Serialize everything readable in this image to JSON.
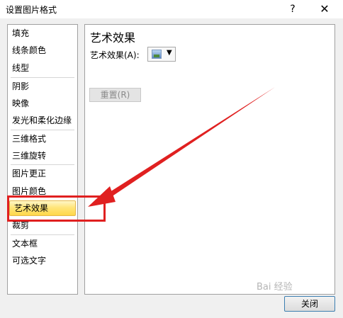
{
  "window": {
    "title": "设置图片格式",
    "help_glyph": "?",
    "close_glyph": "✕"
  },
  "sidebar": {
    "items": [
      {
        "label": "填充"
      },
      {
        "label": "线条颜色"
      },
      {
        "label": "线型"
      },
      {
        "label": "阴影"
      },
      {
        "label": "映像"
      },
      {
        "label": "发光和柔化边缘"
      },
      {
        "label": "三维格式"
      },
      {
        "label": "三维旋转"
      },
      {
        "label": "图片更正"
      },
      {
        "label": "图片颜色"
      },
      {
        "label": "艺术效果"
      },
      {
        "label": "裁剪"
      },
      {
        "label": "文本框"
      },
      {
        "label": "可选文字"
      }
    ],
    "selected_label": "艺术效果"
  },
  "panel": {
    "heading": "艺术效果",
    "effect_label": "艺术效果(A):",
    "dropdown_arrow": "▼",
    "reset_label": "重置(R)"
  },
  "footer": {
    "close_label": "关闭"
  },
  "annotation": {
    "color": "#e02020"
  },
  "watermark": {
    "text": "Bai 经验"
  },
  "colors": {
    "selection": "#ffe57a",
    "accent_border": "#3c7fb1"
  }
}
